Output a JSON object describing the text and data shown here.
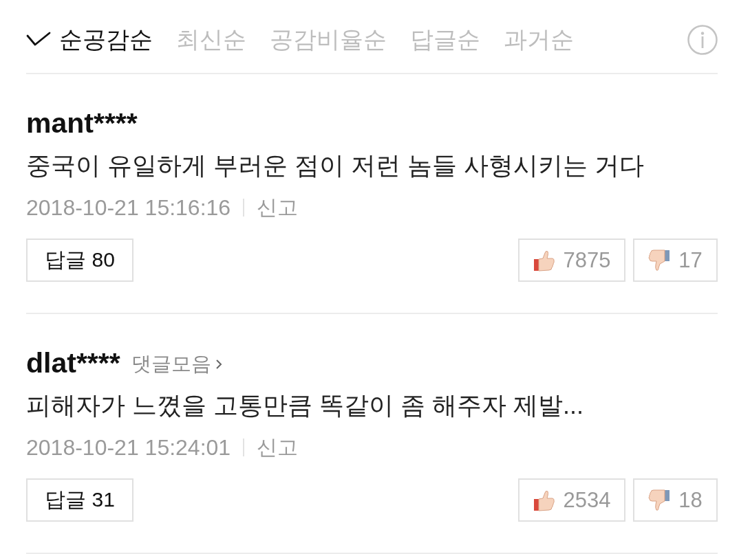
{
  "sort_options": [
    {
      "label": "순공감순",
      "selected": true
    },
    {
      "label": "최신순",
      "selected": false
    },
    {
      "label": "공감비율순",
      "selected": false
    },
    {
      "label": "답글순",
      "selected": false
    },
    {
      "label": "과거순",
      "selected": false
    }
  ],
  "comments": [
    {
      "username": "mant****",
      "text": "중국이 유일하게 부러운 점이 저런 놈들 사형시키는 거다",
      "timestamp": "2018-10-21 15:16:16",
      "report_label": "신고",
      "reply_label": "답글",
      "reply_count": "80",
      "likes": "7875",
      "dislikes": "17"
    },
    {
      "username": "dlat****",
      "collection_link": "댓글모음",
      "text": "피해자가 느꼈을 고통만큼 똑같이 좀 해주자 제발...",
      "timestamp": "2018-10-21 15:24:01",
      "report_label": "신고",
      "reply_label": "답글",
      "reply_count": "31",
      "likes": "2534",
      "dislikes": "18"
    }
  ]
}
